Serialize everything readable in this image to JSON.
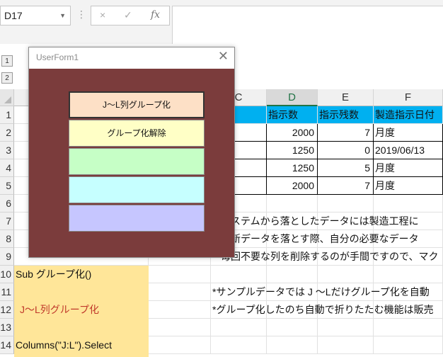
{
  "formula_bar": {
    "name_box": "D17",
    "cancel_icon": "×",
    "enter_icon": "✓",
    "fx_label": "fx"
  },
  "outline_levels": [
    "1",
    "2"
  ],
  "columns": [
    "C",
    "D",
    "E",
    "F"
  ],
  "rows": [
    "1",
    "2",
    "3",
    "4",
    "5",
    "6",
    "7",
    "8",
    "9",
    "10",
    "11",
    "12",
    "13",
    "14"
  ],
  "table": {
    "headers": [
      "指示数",
      "指示残数",
      "製造指示日付"
    ],
    "data": [
      [
        "2000",
        "7",
        "月度"
      ],
      [
        "1250",
        "0",
        "2019/06/13"
      ],
      [
        "1250",
        "5",
        "月度"
      ],
      [
        "2000",
        "7",
        "月度"
      ]
    ]
  },
  "notes": {
    "r7": "システムから落としたデータには製造工程に",
    "r8": "最新データを落とす際、自分の必要なデータ",
    "r9": "毎回不要な列を削除するのが手間ですので、マク",
    "r11": "*サンプルデータでは J ～Lだけグループ化を自動",
    "r12": "*グループ化したのち自動で折りたたむ機能は販売"
  },
  "code": {
    "r10": "Sub グループ化()",
    "r12": "J～L列グループ化",
    "r14": "Columns(\"J:L\").Select"
  },
  "dialog": {
    "title": "UserForm1",
    "close_icon": "✕",
    "buttons": [
      {
        "label": "J～L列グループ化",
        "color": "#fde0c6"
      },
      {
        "label": "グループ化解除",
        "color": "#ffffc6"
      },
      {
        "label": "",
        "color": "#c6ffc6"
      },
      {
        "label": "",
        "color": "#c6ffff"
      },
      {
        "label": "",
        "color": "#c6c6ff"
      }
    ]
  },
  "colors": {
    "header_fill": "#00b0f0",
    "code_fill": "#ffe699",
    "form_bg": "#7b3c3c",
    "code_red_text": "#c0392b"
  }
}
